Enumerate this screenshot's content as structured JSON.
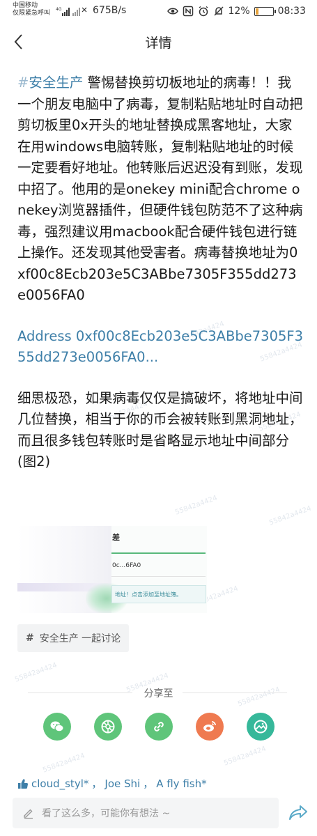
{
  "status_bar": {
    "carrier_line1": "中国移动",
    "carrier_line2": "仅限紧急呼叫",
    "net_type": "4G",
    "net_speed": "675B/s",
    "battery": "12%",
    "battery_level": 0.12,
    "time": "08:33"
  },
  "header": {
    "title": "详情",
    "back_icon": "chevron-left-icon"
  },
  "post": {
    "hashtag_symbol": "#",
    "hashtag": "安全生产",
    "body1": " 警惕替换剪切板地址的病毒！！我一个朋友电脑中了病毒，复制粘贴地址时自动把剪切板里0x开头的地址替换成黑客地址，大家在用windows电脑转账，复制粘贴地址的时候一定要看好地址。他转账后迟迟没有到账，发现中招了。他用的是onekey mini配合chrome onekey浏览器插件，但硬件钱包防范不了这种病毒，强烈建议用macbook配合硬件钱包进行链上操作。还发现其他受害者。病毒替换地址为0xf00c8Ecb203e5C3ABbe7305F355dd273e0056FA0",
    "address_link": "Address 0xf00c8Ecb203e5C3ABbe7305F355dd273e0056FA0...",
    "body2": "细思极恐，如果病毒仅仅是搞破坏，将地址中间几位替换，相当于你的币会被转账到黑洞地址，而且很多钱包转账时是省略显示地址中间部分(图2)"
  },
  "image": {
    "text_top": "差",
    "text_addr": "0c...6FA0",
    "text_hint": "地址！点击添加至地址簿。"
  },
  "topic": {
    "symbol": "#",
    "label": "安全生产 一起讨论"
  },
  "share": {
    "label": "分享至",
    "targets": [
      {
        "name": "wechat-icon",
        "color": "#5fc57a"
      },
      {
        "name": "moments-icon",
        "color": "#5fc57a"
      },
      {
        "name": "link-icon",
        "color": "#5fc57a"
      },
      {
        "name": "weibo-icon",
        "color": "#ef7a50"
      },
      {
        "name": "image-share-icon",
        "color": "#36b89a"
      }
    ]
  },
  "likes": {
    "users": [
      "cloud_styl*",
      "Joe Shi",
      "A fly fish*"
    ],
    "separator": "，"
  },
  "comment": {
    "placeholder": "看了这么多，可能你有想法 ~"
  },
  "watermark": "55842a4424"
}
